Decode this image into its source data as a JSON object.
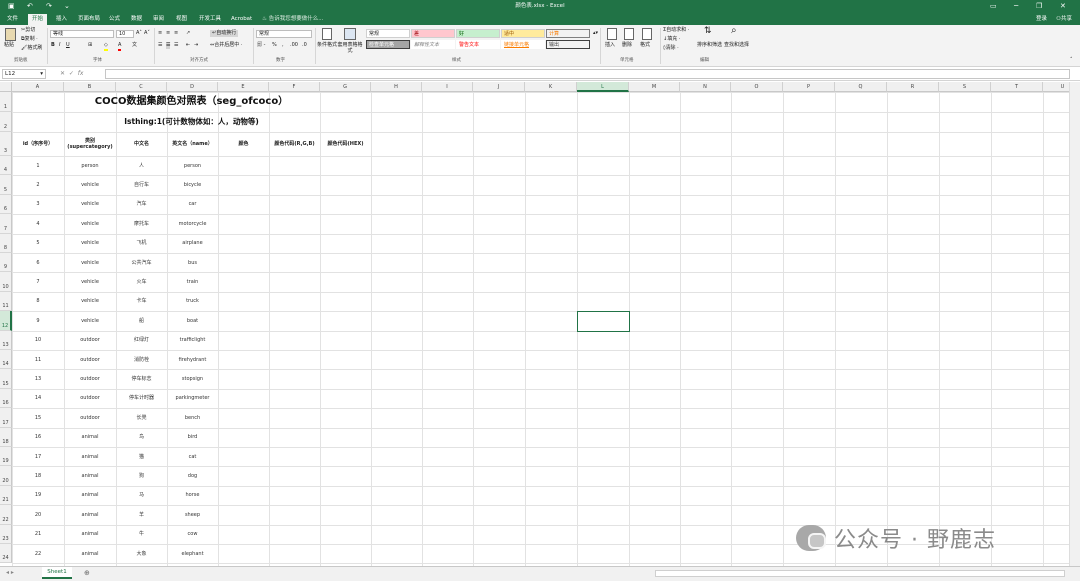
{
  "window": {
    "doc_title": "颜色表.xlsx - Excel",
    "quick_access": [
      "save-icon",
      "undo-icon",
      "redo-icon"
    ],
    "controls": [
      "ribbon-display-icon",
      "minimize-icon",
      "restore-icon",
      "close-icon"
    ]
  },
  "ribbon_tabs": [
    "文件",
    "开始",
    "插入",
    "页面布局",
    "公式",
    "数据",
    "审阅",
    "视图",
    "开发工具",
    "Acrobat"
  ],
  "active_tab": "开始",
  "tell_me": "告诉我您想要做什么...",
  "account": {
    "user": "登录",
    "share": "共享"
  },
  "clipboard": {
    "paste": "粘贴",
    "cut": "剪切",
    "copy": "复制 ·",
    "format_painter": "格式刷",
    "label": "剪贴板"
  },
  "font": {
    "name": "等线",
    "size": "10",
    "label": "字体"
  },
  "alignment": {
    "wrap": "自动换行",
    "merge": "合并后居中 ·",
    "label": "对齐方式"
  },
  "number": {
    "format": "常规",
    "label": "数字"
  },
  "styles": {
    "cond_format": "条件格式",
    "table_format": "套用表格格式",
    "cells": [
      {
        "text": "常规",
        "bg": "#ffffff",
        "fg": "#222222",
        "border": "#cfcfcf"
      },
      {
        "text": "差",
        "bg": "#ffc7ce",
        "fg": "#9c0006",
        "border": "#cfcfcf"
      },
      {
        "text": "好",
        "bg": "#c6efce",
        "fg": "#006100",
        "border": "#cfcfcf"
      },
      {
        "text": "适中",
        "bg": "#ffeb9c",
        "fg": "#9c5700",
        "border": "#cfcfcf"
      },
      {
        "text": "计算",
        "bg": "#f2f2f2",
        "fg": "#fa7d00",
        "border": "#7f7f7f"
      },
      {
        "text": "检查单元格",
        "bg": "#a5a5a5",
        "fg": "#ffffff",
        "border": "#3f3f3f"
      },
      {
        "text": "解释性文本",
        "bg": "#ffffff",
        "fg": "#7f7f7f",
        "border": "#ffffff"
      },
      {
        "text": "警告文本",
        "bg": "#ffffff",
        "fg": "#ff0000",
        "border": "#ffffff"
      },
      {
        "text": "链接单元格",
        "bg": "#ffffff",
        "fg": "#fa7d00",
        "border": "#ffffff"
      },
      {
        "text": "输出",
        "bg": "#f2f2f2",
        "fg": "#3f3f3f",
        "border": "#3f3f3f"
      }
    ],
    "label": "样式"
  },
  "cells_group": {
    "insert": "插入",
    "delete": "删除",
    "format": "格式",
    "label": "单元格"
  },
  "editing": {
    "autosum": "自动求和 ·",
    "fill": "填充 ·",
    "clear": "清除 ·",
    "sort": "排序和筛选",
    "find": "查找和选择",
    "label": "编辑"
  },
  "formula_bar": {
    "name_box": "L12",
    "fx": "fx",
    "value": ""
  },
  "columns": [
    "A",
    "B",
    "C",
    "D",
    "E",
    "F",
    "G",
    "H",
    "I",
    "J",
    "K",
    "L",
    "M",
    "N",
    "O",
    "P",
    "Q",
    "R",
    "S",
    "T",
    "U"
  ],
  "selected_cell": "L12",
  "sheet": {
    "title": "COCO数据集颜色对照表（seg_ofcoco）",
    "subtitle": "Isthing:1(可计数物体如：人，动物等)",
    "headers": [
      "id（序序号）",
      "类别\n(supercategory)",
      "中文名",
      "英文名（name）",
      "颜色",
      "颜色代码(R,G,B)",
      "颜色代码(HEX)"
    ],
    "rows": [
      [
        "1",
        "person",
        "人",
        "person"
      ],
      [
        "2",
        "vehicle",
        "自行车",
        "bicycle"
      ],
      [
        "3",
        "vehicle",
        "汽车",
        "car"
      ],
      [
        "4",
        "vehicle",
        "摩托车",
        "motorcycle"
      ],
      [
        "5",
        "vehicle",
        "飞机",
        "airplane"
      ],
      [
        "6",
        "vehicle",
        "公共汽车",
        "bus"
      ],
      [
        "7",
        "vehicle",
        "火车",
        "train"
      ],
      [
        "8",
        "vehicle",
        "卡车",
        "truck"
      ],
      [
        "9",
        "vehicle",
        "船",
        "boat"
      ],
      [
        "10",
        "outdoor",
        "红绿灯",
        "trafficlight"
      ],
      [
        "11",
        "outdoor",
        "消防栓",
        "firehydrant"
      ],
      [
        "13",
        "outdoor",
        "停车标志",
        "stopsign"
      ],
      [
        "14",
        "outdoor",
        "停车计时器",
        "parkingmeter"
      ],
      [
        "15",
        "outdoor",
        "长凳",
        "bench"
      ],
      [
        "16",
        "animal",
        "鸟",
        "bird"
      ],
      [
        "17",
        "animal",
        "猫",
        "cat"
      ],
      [
        "18",
        "animal",
        "狗",
        "dog"
      ],
      [
        "19",
        "animal",
        "马",
        "horse"
      ],
      [
        "20",
        "animal",
        "羊",
        "sheep"
      ],
      [
        "21",
        "animal",
        "牛",
        "cow"
      ],
      [
        "22",
        "animal",
        "大象",
        "elephant"
      ]
    ]
  },
  "sheet_tabs": [
    "Sheet1"
  ],
  "watermark": "公众号 · 野鹿志"
}
